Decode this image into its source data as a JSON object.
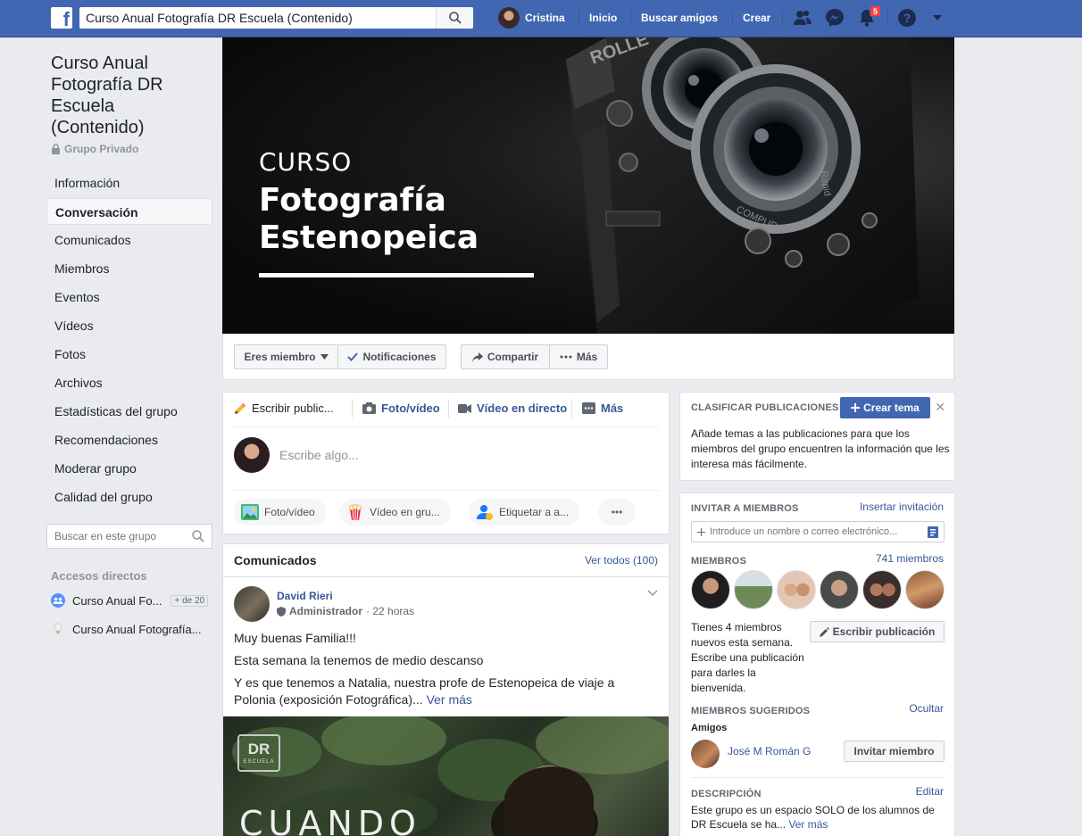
{
  "topbar": {
    "logo": "f",
    "search_value": "Curso Anual Fotografía DR Escuela (Contenido)",
    "user_name": "Cristina",
    "links": [
      "Inicio",
      "Buscar amigos",
      "Crear"
    ],
    "notification_count": "5",
    "brand_color": "#4267b2"
  },
  "group": {
    "title": "Curso Anual Fotografía DR Escuela (Contenido)",
    "privacy": "Grupo Privado"
  },
  "sidebar": {
    "items": [
      {
        "label": "Información"
      },
      {
        "label": "Conversación"
      },
      {
        "label": "Comunicados"
      },
      {
        "label": "Miembros"
      },
      {
        "label": "Eventos"
      },
      {
        "label": "Vídeos"
      },
      {
        "label": "Fotos"
      },
      {
        "label": "Archivos"
      },
      {
        "label": "Estadísticas del grupo"
      },
      {
        "label": "Recomendaciones"
      },
      {
        "label": "Moderar grupo"
      },
      {
        "label": "Calidad del grupo"
      }
    ],
    "search_placeholder": "Buscar en este grupo",
    "shortcuts_title": "Accesos directos",
    "shortcuts": [
      {
        "label": "Curso Anual Fo...",
        "badge": "+ de 20"
      },
      {
        "label": "Curso Anual Fotografía..."
      }
    ]
  },
  "cover": {
    "line1": "CURSO",
    "line2": "Fotografía",
    "line3": "Estenopeica",
    "camera_text_1": "ROLLE",
    "camera_text_2": "COMPUR",
    "camera_text_3": "Rapid"
  },
  "cover_actions": {
    "member": "Eres miembro",
    "notifications": "Notificaciones",
    "share": "Compartir",
    "more": "Más"
  },
  "composer": {
    "tabs": [
      "Escribir public...",
      "Foto/vídeo",
      "Vídeo en directo",
      "Más"
    ],
    "placeholder": "Escribe algo...",
    "pills": [
      "Foto/vídeo",
      "Vídeo en gru...",
      "Etiquetar a a..."
    ],
    "more_pill": "•••"
  },
  "feed": {
    "title": "Comunicados",
    "see_all": "Ver todos (100)",
    "post": {
      "author": "David Rieri",
      "role": "Administrador",
      "time": "· 22 horas",
      "p1": "Muy buenas Familia!!!",
      "p2": "Esta semana la tenemos de medio descanso",
      "p3": "Y es que tenemos a Natalia, nuestra profe de Estenopeica de viaje a Polonia (exposición Fotográfica)...",
      "see_more": "Ver más",
      "image_logo": "DR",
      "image_logo_sub": "ESCUELA",
      "image_text": "CUANDO"
    }
  },
  "right": {
    "classify_title": "CLASIFICAR PUBLICACIONES",
    "create_topic": "Crear tema",
    "close": "✕",
    "classify_text": "Añade temas a las publicaciones para que los miembros del grupo encuentren la información que les interesa más fácilmente.",
    "invite_title": "INVITAR A MIEMBROS",
    "insert_invite": "Insertar invitación",
    "invite_placeholder": "Introduce un nombre o correo electrónico...",
    "members_title": "MIEMBROS",
    "members_count": "741 miembros",
    "new_members_text": "Tienes 4 miembros nuevos esta semana. Escribe una publicación para darles la bienvenida.",
    "write_post": "Escribir publicación",
    "suggested_title": "MIEMBROS SUGERIDOS",
    "hide": "Ocultar",
    "friends": "Amigos",
    "suggested_name": "José M Román G",
    "invite_member": "Invitar miembro",
    "description_title": "DESCRIPCIÓN",
    "edit": "Editar",
    "description_text": "Este grupo es un espacio SOLO de los alumnos de DR Escuela se ha...",
    "see_more": "Ver más"
  }
}
